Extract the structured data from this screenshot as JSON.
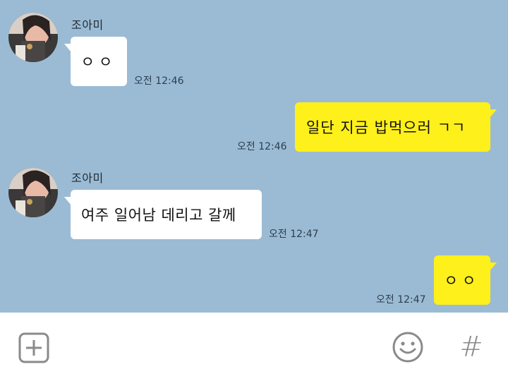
{
  "messages": [
    {
      "sender": "조아미",
      "text": "ㅇㅇ",
      "time": "오전 12:46"
    },
    {
      "text": "일단 지금 밥먹으러 ㄱㄱ",
      "time": "오전 12:46"
    },
    {
      "sender": "조아미",
      "text": "여주 일어남 데리고 갈께",
      "time": "오전 12:47"
    },
    {
      "text": "ㅇㅇ",
      "time": "오전 12:47"
    }
  ],
  "colors": {
    "chat_background": "#9bbbd4",
    "incoming_bubble": "#ffffff",
    "outgoing_bubble": "#fef01b",
    "icon_gray": "#8a8a8a"
  },
  "toolbar": {
    "attach_icon": "plus-square-icon",
    "emoji_icon": "smiley-icon",
    "hash_icon": "hash-icon",
    "hash_label": "#"
  }
}
